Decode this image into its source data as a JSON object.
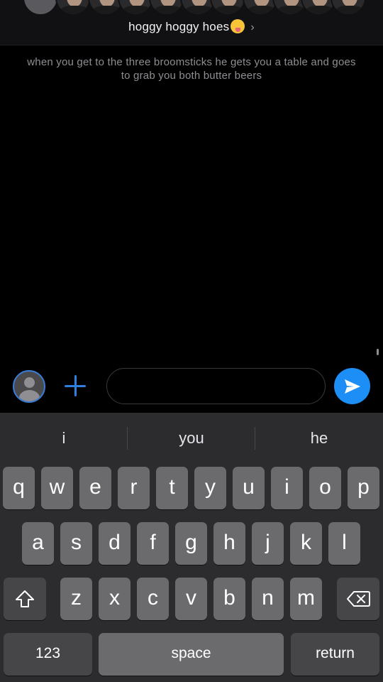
{
  "header": {
    "group_name": "hoggy hoggy hoes",
    "emoji": "zany-face-emoji",
    "chevron": "›",
    "avatars": [
      {
        "name": "avatar-placeholder",
        "hair": "#5a5a5e"
      },
      {
        "name": "member-avatar",
        "hair": "#6a5a48"
      },
      {
        "name": "member-avatar",
        "hair": "#3e3429"
      },
      {
        "name": "member-avatar",
        "hair": "#b7a68a"
      },
      {
        "name": "member-avatar",
        "hair": "#2e2620"
      },
      {
        "name": "member-avatar",
        "hair": "#4b3a2e"
      },
      {
        "name": "member-avatar",
        "hair": "#d8c7a0"
      },
      {
        "name": "member-avatar",
        "hair": "#5a4636"
      },
      {
        "name": "member-avatar",
        "hair": "#3a2c22"
      },
      {
        "name": "member-avatar",
        "hair": "#c9a870"
      },
      {
        "name": "member-avatar",
        "hair": "#2a221c"
      }
    ]
  },
  "messages": [
    {
      "text": "when you get to the three broomsticks he gets you a table and goes to grab you both butter beers"
    }
  ],
  "composer": {
    "placeholder": "",
    "value": "",
    "profile_icon": "profile-icon",
    "add_icon": "plus-icon",
    "send_icon": "send-icon",
    "accent_color": "#1d8ef5"
  },
  "keyboard": {
    "suggestions": [
      "i",
      "you",
      "he"
    ],
    "row1": [
      "q",
      "w",
      "e",
      "r",
      "t",
      "y",
      "u",
      "i",
      "o",
      "p"
    ],
    "row2": [
      "a",
      "s",
      "d",
      "f",
      "g",
      "h",
      "j",
      "k",
      "l"
    ],
    "row3": [
      "z",
      "x",
      "c",
      "v",
      "b",
      "n",
      "m"
    ],
    "numbers_label": "123",
    "space_label": "space",
    "return_label": "return"
  }
}
